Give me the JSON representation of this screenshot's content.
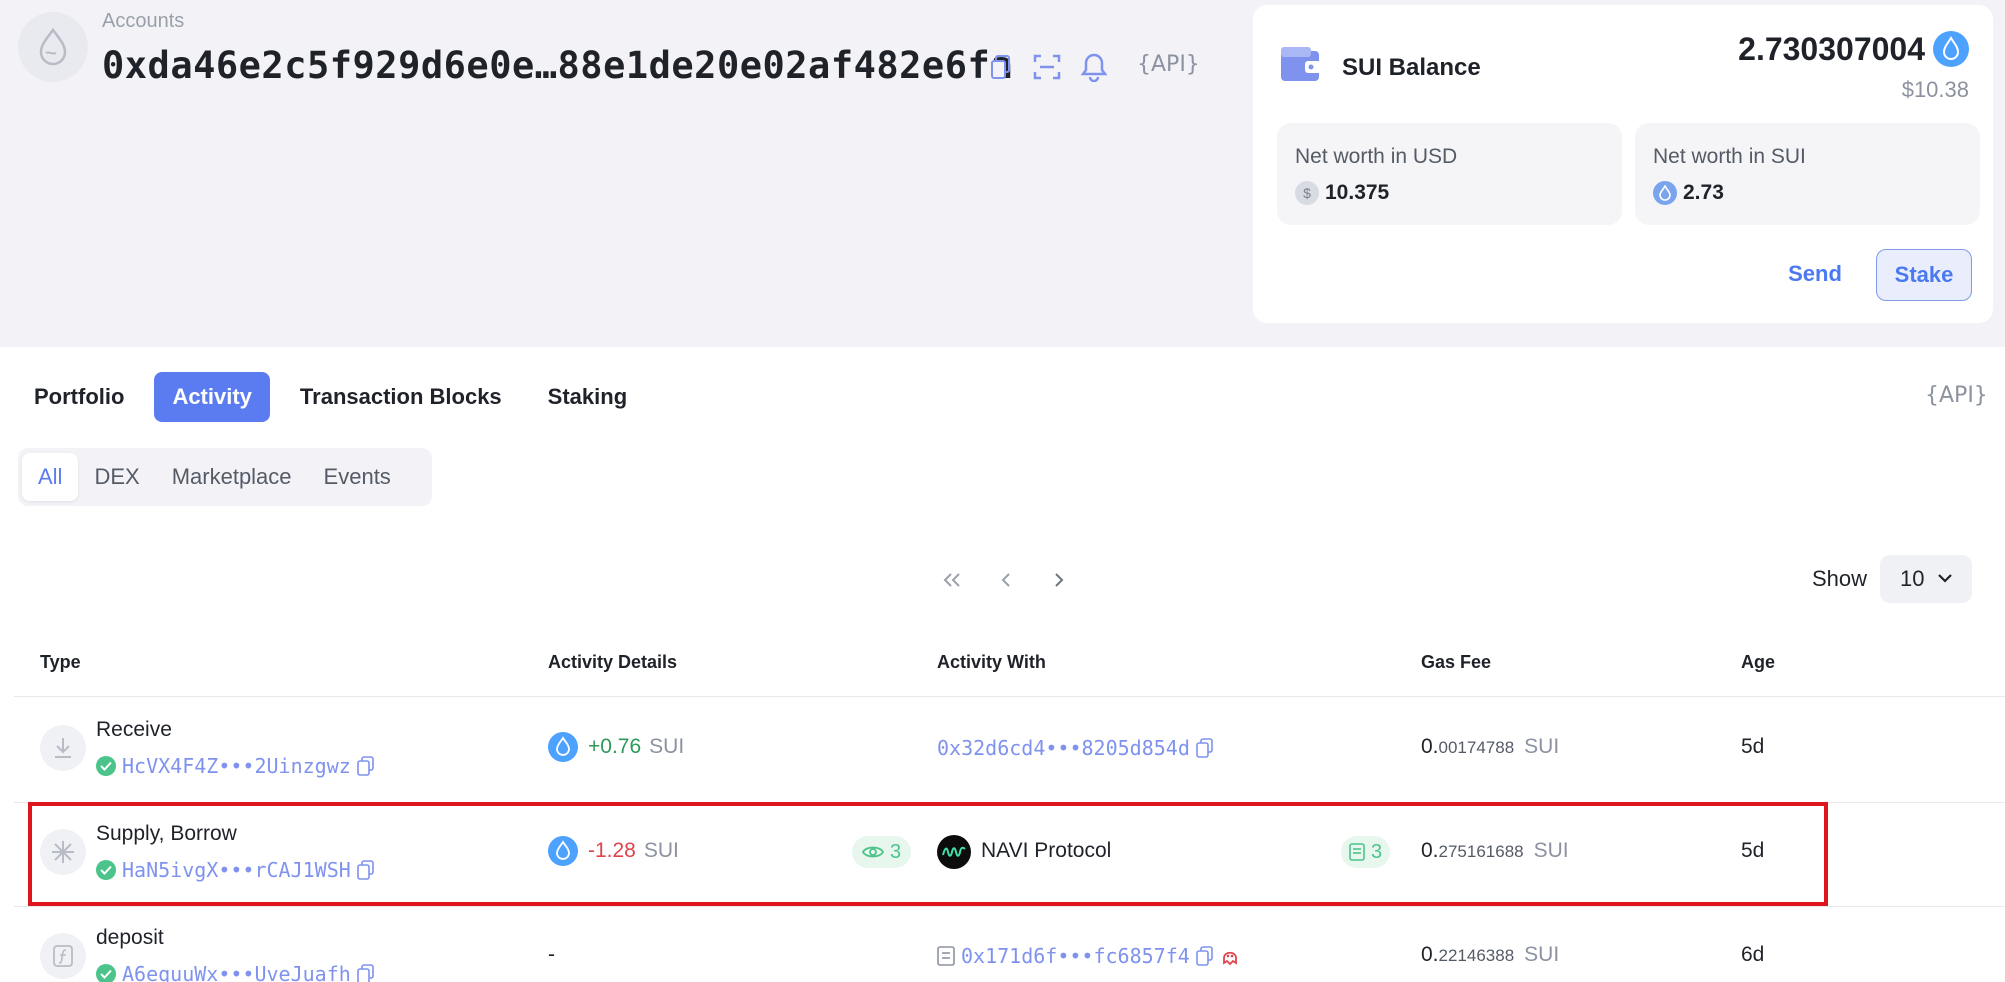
{
  "header": {
    "accounts_label": "Accounts",
    "address": "0xda46e2c5f929d6e0e…88e1de20e02af482e6fa",
    "api_label": "{API}"
  },
  "balance": {
    "title": "SUI Balance",
    "amount": "2.730307004",
    "usd": "$10.38",
    "net_worth_usd_label": "Net worth in USD",
    "net_worth_usd_value": "10.375",
    "net_worth_sui_label": "Net worth in SUI",
    "net_worth_sui_value": "2.73",
    "send_label": "Send",
    "stake_label": "Stake"
  },
  "tabs": [
    {
      "label": "Portfolio",
      "active": false
    },
    {
      "label": "Activity",
      "active": true
    },
    {
      "label": "Transaction Blocks",
      "active": false
    },
    {
      "label": "Staking",
      "active": false
    }
  ],
  "tabs_api_label": "{API}",
  "subtabs": [
    {
      "label": "All",
      "active": true
    },
    {
      "label": "DEX",
      "active": false
    },
    {
      "label": "Marketplace",
      "active": false
    },
    {
      "label": "Events",
      "active": false
    }
  ],
  "pager": {
    "show_label": "Show",
    "page_size": "10"
  },
  "table": {
    "columns": [
      "Type",
      "Activity Details",
      "Activity With",
      "Gas Fee",
      "Age"
    ],
    "rows": [
      {
        "type": "Receive",
        "digest": "HcVX4F4Z•••2Uinzgwz",
        "amount": "+0.76",
        "unit": "SUI",
        "with": "0x32d6cd4•••8205d854d",
        "gas_int": "0.",
        "gas_frac": "00174788",
        "gas_unit": "SUI",
        "age": "5d"
      },
      {
        "type": "Supply, Borrow",
        "digest": "HaN5ivgX•••rCAJ1WSH",
        "amount": "-1.28",
        "unit": "SUI",
        "details_badge": "3",
        "with": "NAVI Protocol",
        "with_badge": "3",
        "gas_int": "0.",
        "gas_frac": "275161688",
        "gas_unit": "SUI",
        "age": "5d"
      },
      {
        "type": "deposit",
        "digest": "A6equuWx•••UveJuafh",
        "details": "-",
        "with": "0x171d6f•••fc6857f4",
        "gas_int": "0.",
        "gas_frac": "22146388",
        "gas_unit": "SUI",
        "age": "6d"
      }
    ]
  },
  "colors": {
    "accent": "#5a7cf0",
    "link": "#7f93ee",
    "positive": "#2e9a5a",
    "negative": "#e0434b",
    "success": "#4cc38a",
    "highlight": "#e0161f"
  }
}
